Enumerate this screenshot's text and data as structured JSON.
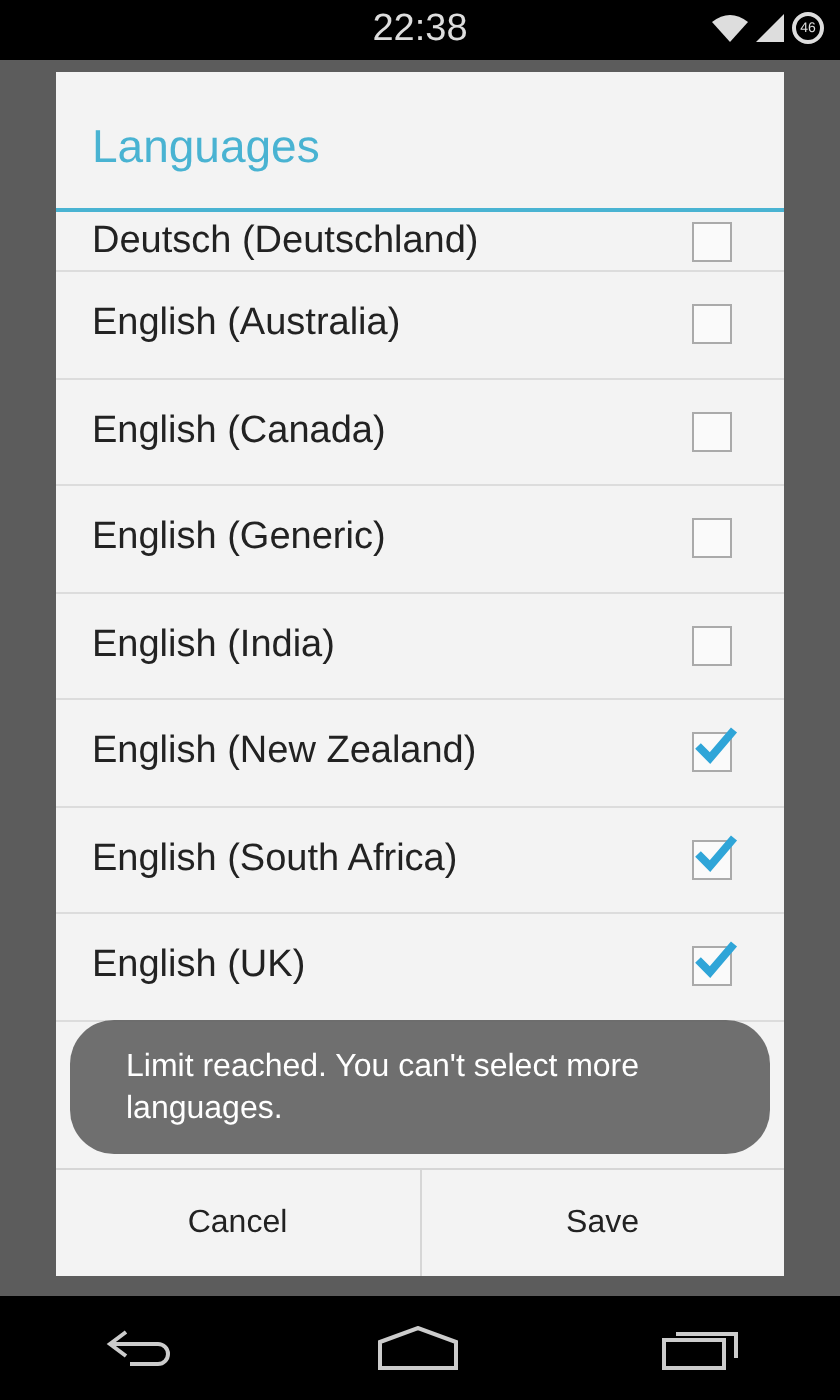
{
  "status_bar": {
    "time": "22:38",
    "battery": "46"
  },
  "dialog": {
    "title": "Languages",
    "languages": [
      {
        "label": "Deutsch (Deutschland)",
        "checked": false
      },
      {
        "label": "English (Australia)",
        "checked": false
      },
      {
        "label": "English (Canada)",
        "checked": false
      },
      {
        "label": "English (Generic)",
        "checked": false
      },
      {
        "label": "English (India)",
        "checked": false
      },
      {
        "label": "English (New Zealand)",
        "checked": true
      },
      {
        "label": "English (South Africa)",
        "checked": true
      },
      {
        "label": "English (UK)",
        "checked": true
      }
    ],
    "buttons": [
      "Cancel",
      "Save"
    ]
  },
  "toast": "Limit reached. You can't select more languages."
}
